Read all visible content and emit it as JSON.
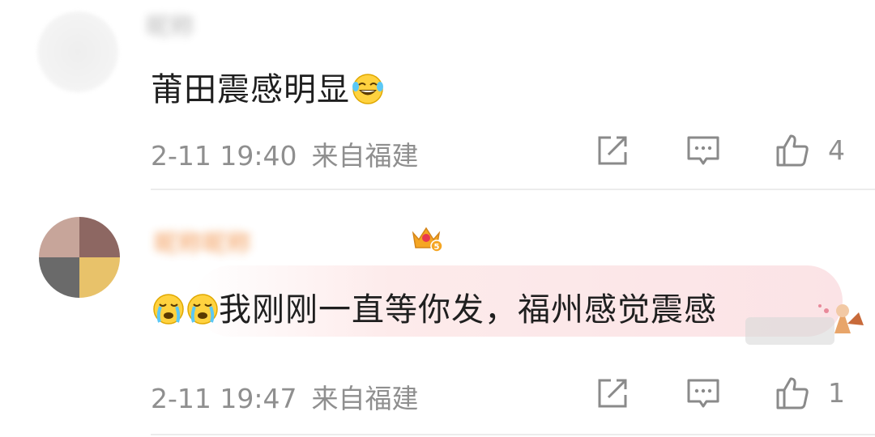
{
  "comments": [
    {
      "username": "昵称",
      "content": "莆田震感明显",
      "content_emojis": [
        "laughing-tears-emoji"
      ],
      "time": "2-11 19:40",
      "location": "来自福建",
      "likes": "4"
    },
    {
      "username": "昵称昵称",
      "leading_emojis": [
        "crying-emoji",
        "crying-emoji"
      ],
      "content": "我刚刚一直等你发，福州感觉震感",
      "time": "2-11 19:47",
      "location": "来自福建",
      "likes": "1",
      "badge_icon": "crown-badge-icon",
      "badge_level": "5"
    }
  ],
  "icons": {
    "share": "share-icon",
    "reply": "comment-icon",
    "like": "thumbs-up-icon"
  },
  "colors": {
    "text_primary": "#1f1f1f",
    "text_meta": "#8f8f8f",
    "username_highlight": "#f08a3c",
    "highlight_bg": "#fbe3e6"
  }
}
